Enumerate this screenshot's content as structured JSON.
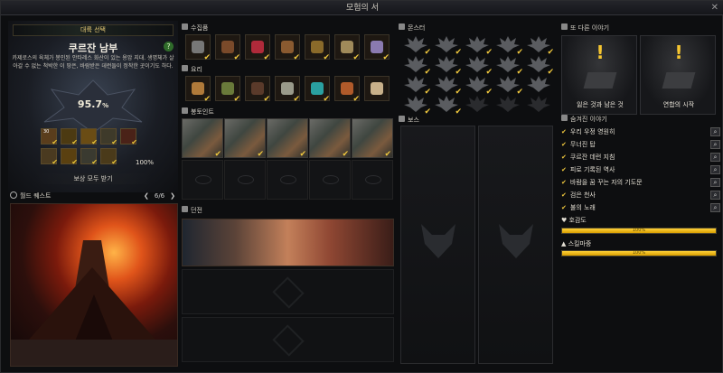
{
  "window": {
    "title": "모험의 서"
  },
  "region": {
    "select_label": "대륙 선택",
    "name": "쿠르잔 남부",
    "description": "카제로스의 육체가 봉인된 안타레스 화산이 있는 용암 지대. 생명체가 살아갈 수 없는 척박한 이 땅은, 바람받은 데런들이 정착한 곳이기도 하다.",
    "progress_value": "95.7",
    "progress_unit": "%",
    "reward_stack_count": "30",
    "reward_percent": "100%",
    "claim_label": "보상 모두 받기"
  },
  "world_quest": {
    "label": "월드 퀘스트",
    "page": "6/6"
  },
  "sections": {
    "collectibles": "수집품",
    "cooking": "요리",
    "battle_points": "봉토인트",
    "dungeon": "던전",
    "monster": "몬스터",
    "boss": "보스",
    "other_story": "또 다른 이야기",
    "hidden_story": "숨겨진 이야기",
    "affinity": "호감도",
    "skill_flower": "스킬마중"
  },
  "other_stories": [
    {
      "label": "잃은 것과 남은 것"
    },
    {
      "label": "연합의 시작"
    }
  ],
  "hidden_stories": [
    {
      "label": "우리 우정 영원히"
    },
    {
      "label": "무너진 탑"
    },
    {
      "label": "쿠르잔 데런 지침"
    },
    {
      "label": "피로 기록된 역사"
    },
    {
      "label": "바람을 꿈 꾸는 자의 기도문"
    },
    {
      "label": "검은 천사"
    },
    {
      "label": "불의 노래"
    }
  ],
  "bars": {
    "affinity": {
      "value": 1.0,
      "text": "100%"
    },
    "skill": {
      "value": 1.0,
      "text": "100%"
    }
  },
  "colors": {
    "accent": "#f1c93e",
    "bar": "#ffd23a",
    "bg": "#0d0e10"
  }
}
